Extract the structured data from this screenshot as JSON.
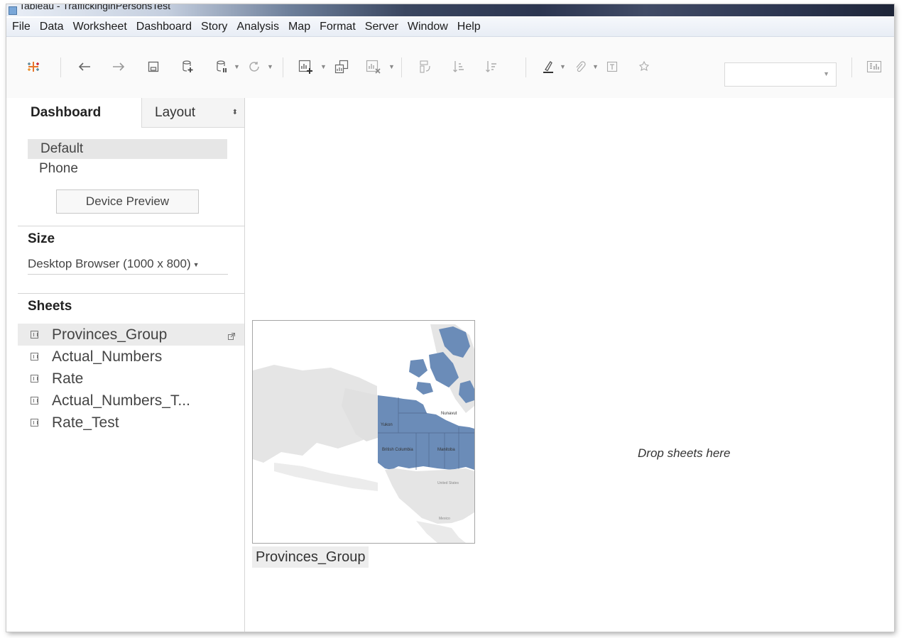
{
  "window": {
    "title": "Tableau - TraffickinginPersonsTest"
  },
  "menu": [
    "File",
    "Data",
    "Worksheet",
    "Dashboard",
    "Story",
    "Analysis",
    "Map",
    "Format",
    "Server",
    "Window",
    "Help"
  ],
  "toolbar": {
    "icons": [
      "tableau-logo-icon",
      "undo-icon",
      "redo-icon",
      "save-icon",
      "new-data-source-icon",
      "pause-updates-icon",
      "refresh-icon",
      "new-worksheet-icon",
      "duplicate-sheet-icon",
      "clear-sheet-icon",
      "swap-icon",
      "sort-ascending-icon",
      "sort-descending-icon",
      "highlight-icon",
      "group-icon",
      "labels-icon",
      "fix-axes-icon",
      "show-me-icon"
    ],
    "fit_value": ""
  },
  "left_panel": {
    "tabs": {
      "dashboard": "Dashboard",
      "layout": "Layout"
    },
    "devices": {
      "default": "Default",
      "phone": "Phone",
      "preview_button": "Device Preview"
    },
    "size": {
      "title": "Size",
      "value": "Desktop Browser (1000 x 800)"
    },
    "sheets": {
      "title": "Sheets",
      "items": [
        {
          "label": "Provinces_Group"
        },
        {
          "label": "Actual_Numbers"
        },
        {
          "label": "Rate"
        },
        {
          "label": "Actual_Numbers_T..."
        },
        {
          "label": "Rate_Test"
        }
      ]
    }
  },
  "canvas": {
    "sheet_caption": "Provinces_Group",
    "drop_text": "Drop sheets here",
    "map_labels": {
      "yukon": "Yukon",
      "nunavut": "Nunavut",
      "bc": "British Columbia",
      "manitoba": "Manitoba",
      "us": "United States",
      "mexico": "Mexico"
    },
    "colors": {
      "canada_fill": "#6b8cb8",
      "land_fill": "#e5e5e5",
      "accent": "#1f77b4"
    }
  }
}
